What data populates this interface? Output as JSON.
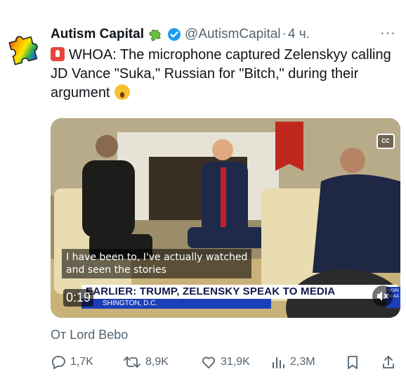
{
  "tweet": {
    "author_name": "Autism Capital",
    "handle": "@AutismCapital",
    "separator": "·",
    "time": "4 ч.",
    "more": "···",
    "text": "WHOA: The microphone captured Zelenskyy calling JD Vance \"Suka,\" Russian for \"Bitch,\" during their argument",
    "icons": {
      "prefix": "siren-emoji",
      "suffix": "astonished-face-emoji",
      "badge_puzzle": "puzzle-icon",
      "badge_verified": "verified-icon"
    }
  },
  "video": {
    "caption_line1": "I have been to, I've actually watched",
    "caption_line2": "and seen the stories",
    "banner": "EARLIER: TRUMP, ZELENSKY SPEAK TO MEDIA",
    "banner_sub": "SHINGTON, D.C.",
    "timestamp": "0:19",
    "cc_label": "CC",
    "corner_logo": "MORI NIIAA"
  },
  "attribution": "От Lord Bebo",
  "actions": {
    "replies": "1,7K",
    "reposts": "8,9K",
    "likes": "31,9K",
    "views": "2,3M"
  },
  "colors": {
    "text": "#0f1419",
    "muted": "#536471",
    "verified": "#1d9bf0"
  }
}
